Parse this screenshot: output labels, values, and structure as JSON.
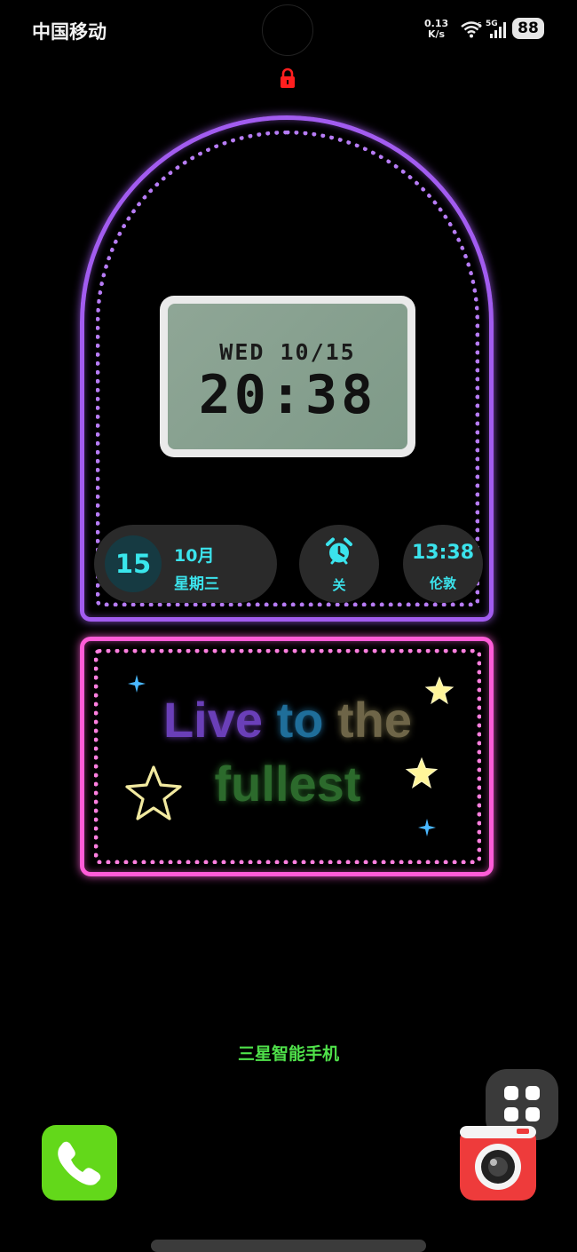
{
  "status_bar": {
    "carrier": "中国移动",
    "net_speed_value": "0.13",
    "net_speed_unit": "K/s",
    "wifi_badge": "5",
    "network_type": "5G",
    "battery": "88",
    "icons": [
      "wifi-icon",
      "signal-icon",
      "battery-icon",
      "lock-icon"
    ]
  },
  "clock_widget": {
    "date": "WED 10/15",
    "time": "20:38"
  },
  "date_widget": {
    "day": "15",
    "month": "10月",
    "weekday": "星期三"
  },
  "alarm_widget": {
    "icon": "alarm-clock-icon",
    "status": "关"
  },
  "world_clock_widget": {
    "time": "13:38",
    "city": "伦敦"
  },
  "quote_widget": {
    "line1_word1": "Live",
    "line1_word2": "to",
    "line1_word3": "the",
    "line2": "fullest"
  },
  "brand_text": "三星智能手机",
  "dock": {
    "phone_icon": "phone-icon",
    "apps_icon": "app-grid-icon",
    "camera_icon": "camera-icon"
  },
  "colors": {
    "arch_frame": "#a25cf0",
    "quote_frame": "#ff5cd8",
    "widget_accent": "#3be3ec",
    "brand_text": "#4fe04a",
    "phone_app": "#63d81a",
    "camera_app": "#ee3b3b"
  }
}
